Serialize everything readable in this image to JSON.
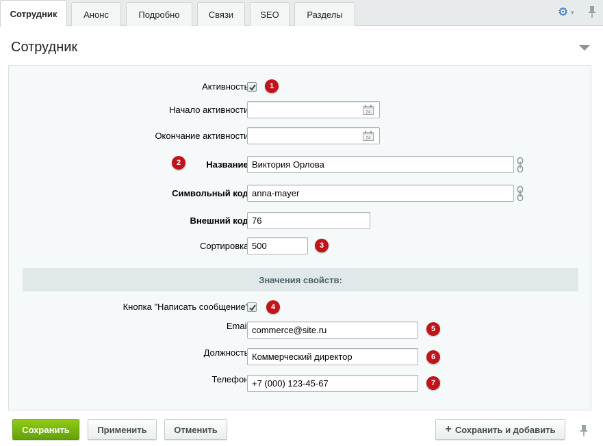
{
  "tabs": [
    {
      "label": "Сотрудник",
      "active": true
    },
    {
      "label": "Анонс"
    },
    {
      "label": "Подробно"
    },
    {
      "label": "Связи"
    },
    {
      "label": "SEO"
    },
    {
      "label": "Разделы"
    }
  ],
  "section": {
    "title": "Сотрудник"
  },
  "form": {
    "active": {
      "label": "Активность:",
      "checked": true,
      "badge": "1"
    },
    "start": {
      "label": "Начало активности:",
      "value": ""
    },
    "end": {
      "label": "Окончание активности:",
      "value": ""
    },
    "name": {
      "label": "Название:",
      "value": "Виктория Орлова",
      "badge": "2"
    },
    "code": {
      "label": "Символьный код:",
      "value": "anna-mayer"
    },
    "xml_id": {
      "label": "Внешний код:",
      "value": "76"
    },
    "sort": {
      "label": "Сортировка:",
      "value": "500",
      "badge": "3"
    }
  },
  "properties": {
    "header": "Значения свойств:",
    "message_button": {
      "label": "Кнопка \"Написать сообщение\":",
      "checked": true,
      "badge": "4"
    },
    "email": {
      "label": "Email:",
      "value": "commerce@site.ru",
      "badge": "5"
    },
    "position": {
      "label": "Должность:",
      "value": "Коммерческий директор",
      "badge": "6"
    },
    "phone": {
      "label": "Телефон:",
      "value": "+7 (000) 123-45-67",
      "badge": "7"
    }
  },
  "calendar_day": "24",
  "buttons": {
    "save": "Сохранить",
    "apply": "Применить",
    "cancel": "Отменить",
    "save_add": "Сохранить и добавить"
  },
  "colors": {
    "badge": "#c0141b",
    "save_button": "#74b20f",
    "gear": "#2a73c5"
  }
}
